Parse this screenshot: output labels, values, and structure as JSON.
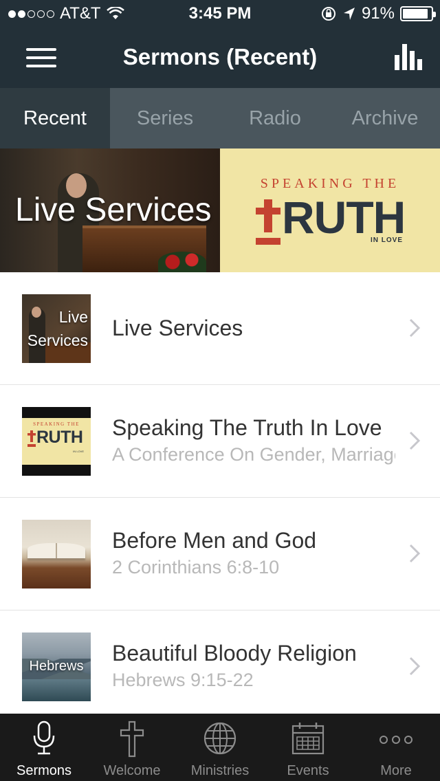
{
  "status_bar": {
    "carrier": "AT&T",
    "time": "3:45 PM",
    "battery": "91%",
    "battery_level": 0.91,
    "signal_bars_filled": 2,
    "signal_bars_total": 5
  },
  "header": {
    "title": "Sermons (Recent)",
    "menu_icon": "hamburger-menu-icon",
    "right_icon": "bar-chart-icon"
  },
  "tabs": [
    {
      "label": "Recent",
      "active": true
    },
    {
      "label": "Series",
      "active": false
    },
    {
      "label": "Radio",
      "active": false
    },
    {
      "label": "Archive",
      "active": false
    }
  ],
  "banner": {
    "live_label": "Live Services",
    "truth_top": "SPEAKING THE",
    "truth_main": "RUTH",
    "truth_sub": "IN LOVE"
  },
  "list": [
    {
      "title": "Live Services",
      "subtitle": "",
      "thumb_text": "Live Services"
    },
    {
      "title": "Speaking The Truth In Love",
      "subtitle": "A Conference On Gender, Marriage",
      "thumb_top": "SPEAKING THE",
      "thumb_main": "RUTH",
      "thumb_sub": "IN LOVE"
    },
    {
      "title": "Before Men and God",
      "subtitle": "2 Corinthians 6:8-10"
    },
    {
      "title": "Beautiful Bloody Religion",
      "subtitle": "Hebrews 9:15-22",
      "thumb_text": "Hebrews"
    }
  ],
  "tab_bar": [
    {
      "label": "Sermons",
      "icon": "microphone-icon",
      "active": true
    },
    {
      "label": "Welcome",
      "icon": "cross-icon",
      "active": false
    },
    {
      "label": "Ministries",
      "icon": "globe-icon",
      "active": false
    },
    {
      "label": "Events",
      "icon": "calendar-icon",
      "active": false
    },
    {
      "label": "More",
      "icon": "more-dots-icon",
      "active": false
    }
  ],
  "colors": {
    "nav_bg": "#233038",
    "tabs_bg": "#4a565d",
    "tab_active_bg": "#2f3b41",
    "truth_red": "#c44230",
    "truth_cream": "#f1e5a5",
    "tab_bar_bg": "#1a1a1a"
  }
}
